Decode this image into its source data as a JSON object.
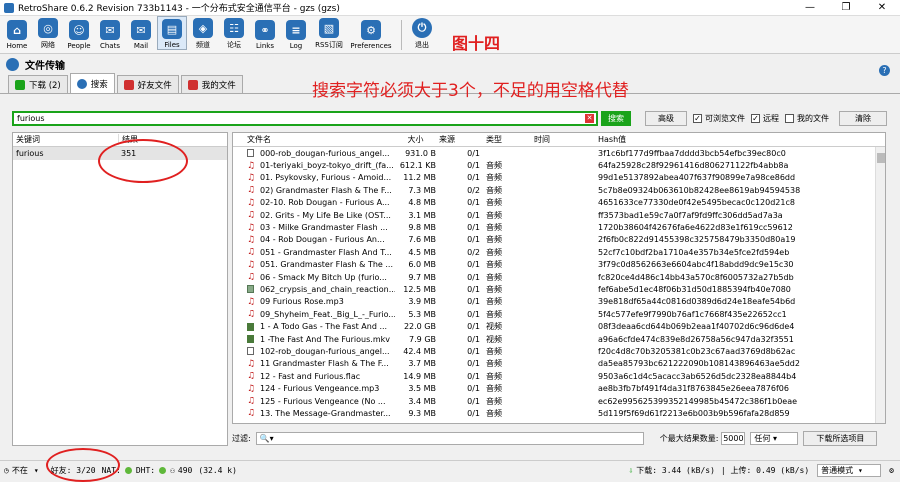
{
  "window": {
    "title": "RetroShare 0.6.2 Revision 733b1143 - 一个分布式安全通信平台 - gzs (gzs)",
    "controls": [
      "—",
      "❐",
      "✕"
    ]
  },
  "toolbar": {
    "items": [
      {
        "label": "Home",
        "color": "#2a6fb5"
      },
      {
        "label": "网络",
        "color": "#2a6fb5"
      },
      {
        "label": "People",
        "color": "#2a6fb5"
      },
      {
        "label": "Chats",
        "color": "#2a6fb5"
      },
      {
        "label": "Mail",
        "color": "#2a6fb5"
      },
      {
        "label": "Files",
        "color": "#2a6fb5"
      },
      {
        "label": "频道",
        "color": "#2a6fb5"
      },
      {
        "label": "论坛",
        "color": "#2a6fb5"
      },
      {
        "label": "Links",
        "color": "#2a6fb5"
      },
      {
        "label": "Log",
        "color": "#2a6fb5"
      },
      {
        "label": "RSS订阅",
        "color": "#2a6fb5"
      },
      {
        "label": "Preferences",
        "color": "#2a6fb5"
      }
    ],
    "quit_label": "退出",
    "annotation": "图十四"
  },
  "panel": {
    "title": "文件传输",
    "help": "?"
  },
  "tabs": [
    {
      "label": "下载 (2)",
      "color": "#1aa31a"
    },
    {
      "label": "搜索",
      "color": "#2a6fb5"
    },
    {
      "label": "好友文件",
      "color": "#d03030"
    },
    {
      "label": "我的文件",
      "color": "#d03030"
    }
  ],
  "annotation_text": "搜索字符必须大于3个，不足的用空格代替",
  "search": {
    "value": "furious",
    "button": "搜索",
    "advanced": "高级",
    "chk_browsable": "可浏览文件",
    "chk_remote": "远程",
    "chk_myfiles": "我的文件",
    "clear": "清除"
  },
  "keywords": {
    "headers": [
      "关键词",
      "结果"
    ],
    "rows": [
      {
        "keyword": "furious",
        "results": "351"
      }
    ]
  },
  "results": {
    "headers": [
      "文件名",
      "大小",
      "来源",
      "类型",
      "时间",
      "Hash值"
    ],
    "rows": [
      {
        "icon": "doc",
        "name": "000-rob_dougan-furious_angel...",
        "size": "931.0 B",
        "src": "0/1",
        "type": "",
        "hash": "3f1c6bf177d9ffbaa7dddd3bcb54efbc39ec80c0"
      },
      {
        "icon": "music",
        "name": "01-teriyaki_boyz-tokyo_drift_(fa...",
        "size": "612.1 KB",
        "src": "0/1",
        "type": "音频",
        "hash": "64fa25928c28f92961416d806271122fb4abb8a"
      },
      {
        "icon": "music",
        "name": "01. Psykovsky, Furious - Amoid...",
        "size": "11.2 MB",
        "src": "0/1",
        "type": "音频",
        "hash": "99d1e5137892abea407f637f90899e7a98ce86dd"
      },
      {
        "icon": "music",
        "name": "02) Grandmaster Flash & The F...",
        "size": "7.3 MB",
        "src": "0/2",
        "type": "音频",
        "hash": "5c7b8e09324b063610b82428ee8619ab94594538"
      },
      {
        "icon": "music",
        "name": "02-10. Rob Dougan - Furious A...",
        "size": "4.8 MB",
        "src": "0/1",
        "type": "音频",
        "hash": "4651633ce77330de0f42e5495becac0c120d21c8"
      },
      {
        "icon": "music",
        "name": "02. Grits - My Life Be Like (OST...",
        "size": "3.1 MB",
        "src": "0/1",
        "type": "音频",
        "hash": "ff3573bad1e59c7a0f7af9fd9ffc306dd5ad7a3a"
      },
      {
        "icon": "music",
        "name": "03 - Milke  Grandmaster Flash ...",
        "size": "9.8 MB",
        "src": "0/1",
        "type": "音频",
        "hash": "1720b38604f42676fa6e4622d83e1f619cc59612"
      },
      {
        "icon": "music",
        "name": "04 - Rob Dougan - Furious An...",
        "size": "7.6 MB",
        "src": "0/1",
        "type": "音频",
        "hash": "2f6fb0c822d91455398c325758479b3350d80a19"
      },
      {
        "icon": "music",
        "name": "051 - Grandmaster Flash And T...",
        "size": "4.5 MB",
        "src": "0/2",
        "type": "音频",
        "hash": "52cf7c10bdf2ba1710a4e357b34e5fce2fd594eb"
      },
      {
        "icon": "music",
        "name": "051. Grandmaster Flash & The ...",
        "size": "6.0 MB",
        "src": "0/1",
        "type": "音频",
        "hash": "3f79c0d8562663e6604abc4f18abdd9dc9e15c30"
      },
      {
        "icon": "music",
        "name": "06 - Smack My Bitch Up (furio...",
        "size": "9.7 MB",
        "src": "0/1",
        "type": "音频",
        "hash": "fc820ce4d486c14bb43a570c8f6005732a27b5db"
      },
      {
        "icon": "gen",
        "name": "062_crypsis_and_chain_reaction...",
        "size": "12.5 MB",
        "src": "0/1",
        "type": "音频",
        "hash": "fef6abe5d1ec48f06b31d50d1885394fb40e7080"
      },
      {
        "icon": "music",
        "name": "09 Furious Rose.mp3",
        "size": "3.9 MB",
        "src": "0/1",
        "type": "音频",
        "hash": "39e818df65a44c0816d0389d6d24e18eafe54b6d"
      },
      {
        "icon": "music",
        "name": "09_Shyheim_Feat._Big_L_-_Furio...",
        "size": "5.3 MB",
        "src": "0/1",
        "type": "音频",
        "hash": "5f4c577efe9f7990b76af1c7668f435e22652cc1"
      },
      {
        "icon": "video",
        "name": "1 - A Todo Gas - The Fast And ...",
        "size": "22.0 GB",
        "src": "0/1",
        "type": "视频",
        "hash": "08f3deaa6cd644b069b2eaa1f40702d6c96d6de4"
      },
      {
        "icon": "video",
        "name": "1 -The Fast And The Furious.mkv",
        "size": "7.9 GB",
        "src": "0/1",
        "type": "视频",
        "hash": "a96a6cfde474c839e8d26758a56c947da32f3551"
      },
      {
        "icon": "doc",
        "name": "102-rob_dougan-furious_angel...",
        "size": "42.4 MB",
        "src": "0/1",
        "type": "音频",
        "hash": "f20c4d8c70b3205381c0b23c67aad3769d8b62ac"
      },
      {
        "icon": "music",
        "name": "11 Grandmaster Flash & The F...",
        "size": "3.7 MB",
        "src": "0/1",
        "type": "音频",
        "hash": "da5ea85793bc621222090b108143896463ae5dd2"
      },
      {
        "icon": "music",
        "name": "12 - Fast and Furious.flac",
        "size": "14.9 MB",
        "src": "0/1",
        "type": "音频",
        "hash": "9503a6c1d4c5acacc3ab6526d5dc2328ea8844b4"
      },
      {
        "icon": "music",
        "name": "124 - Furious Vengeance.mp3",
        "size": "3.5 MB",
        "src": "0/1",
        "type": "音频",
        "hash": "ae8b3fb7bf491f4da31f8763845e26eea7876f06"
      },
      {
        "icon": "music",
        "name": "125 - Furious Vengeance (No ...",
        "size": "3.4 MB",
        "src": "0/1",
        "type": "音频",
        "hash": "ec62e995625399352149985b45472c386f1b0eae"
      },
      {
        "icon": "music",
        "name": "13. The Message-Grandmaster...",
        "size": "9.3 MB",
        "src": "0/1",
        "type": "音频",
        "hash": "5d119f5f69d61f2213e6b003b9b596fafa28d859"
      }
    ]
  },
  "filter": {
    "label": "过滤:",
    "max_label": "个最大结果数量:",
    "max_value": "5000",
    "any": "任何",
    "download_btn": "下载所选项目"
  },
  "status": {
    "presence": "不在",
    "friends": "好友: 3/20",
    "nat": "NAT:",
    "dht": "DHT:",
    "peers": "490",
    "peers_size": "(32.4 k)",
    "download": "下载: 3.44 (kB/s)",
    "upload": "| 上传: 0.49 (kB/s)",
    "mode": "普通模式"
  },
  "icons": {
    "music": "music-note-icon",
    "doc": "document-icon",
    "video": "video-icon",
    "gen": "file-icon"
  }
}
